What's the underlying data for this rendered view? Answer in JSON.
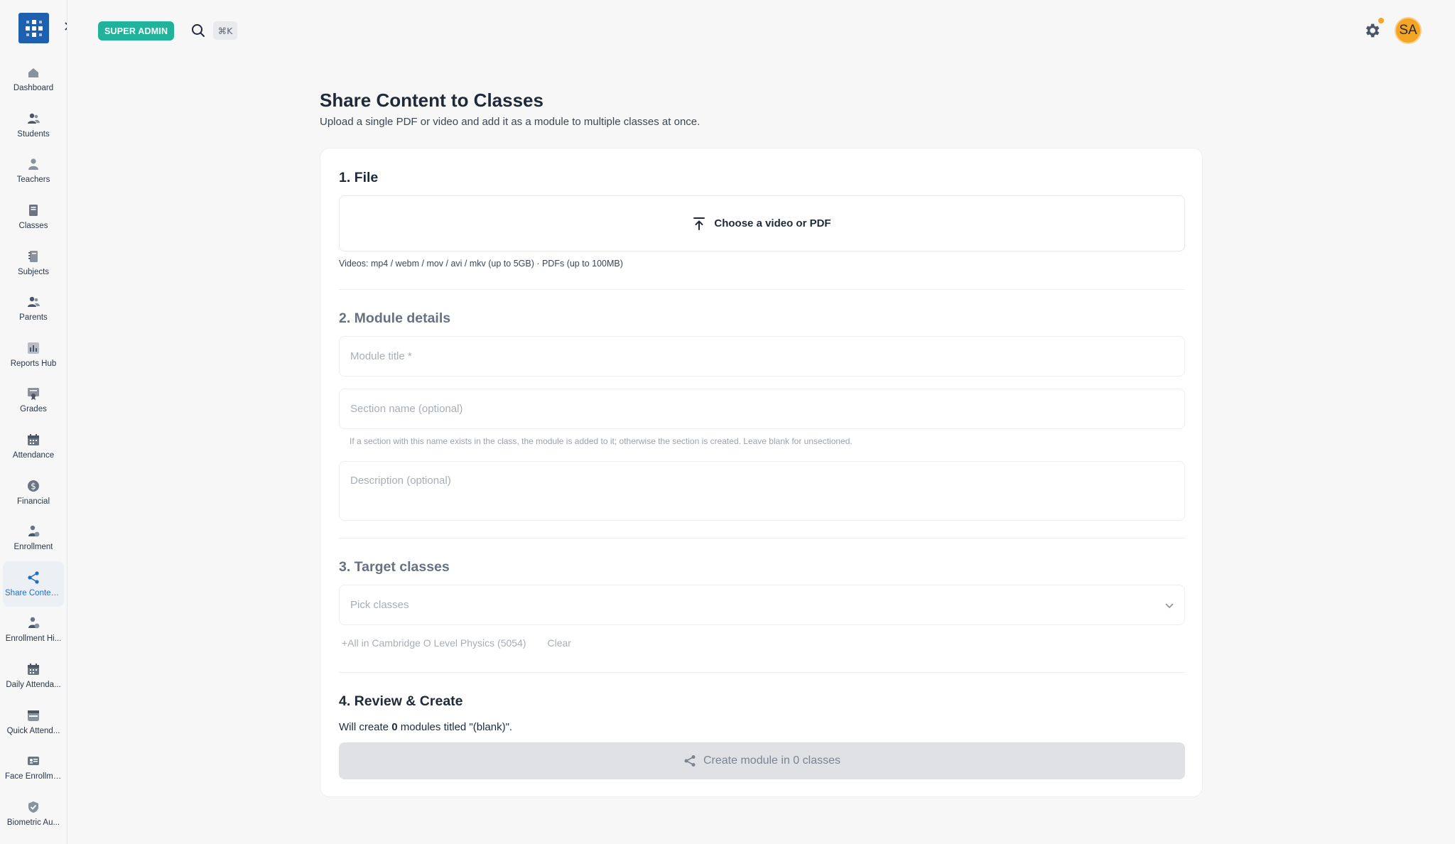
{
  "topbar": {
    "role_badge": "SUPER ADMIN",
    "search_shortcut": "⌘K",
    "avatar_initials": "SA"
  },
  "sidebar": {
    "items": [
      {
        "label": "Dashboard",
        "icon": "home-icon"
      },
      {
        "label": "Students",
        "icon": "users-icon"
      },
      {
        "label": "Teachers",
        "icon": "user-icon"
      },
      {
        "label": "Classes",
        "icon": "book-icon"
      },
      {
        "label": "Subjects",
        "icon": "notebook-icon"
      },
      {
        "label": "Parents",
        "icon": "users-icon"
      },
      {
        "label": "Reports Hub",
        "icon": "bar-chart-icon"
      },
      {
        "label": "Grades",
        "icon": "certificate-icon"
      },
      {
        "label": "Attendance",
        "icon": "calendar-icon"
      },
      {
        "label": "Financial",
        "icon": "dollar-icon"
      },
      {
        "label": "Enrollment",
        "icon": "user-plus-icon"
      },
      {
        "label": "Share Conten...",
        "icon": "share-icon",
        "active": true
      },
      {
        "label": "Enrollment Hi...",
        "icon": "user-history-icon"
      },
      {
        "label": "Daily Attenda...",
        "icon": "calendar-icon"
      },
      {
        "label": "Quick Attend...",
        "icon": "scan-calendar-icon"
      },
      {
        "label": "Face Enrollme...",
        "icon": "id-card-icon"
      },
      {
        "label": "Biometric Au...",
        "icon": "shield-check-icon"
      }
    ]
  },
  "page": {
    "title": "Share Content to Classes",
    "subtitle": "Upload a single PDF or video and add it as a module to multiple classes at once."
  },
  "file_section": {
    "title": "1. File",
    "upload_label": "Choose a video or PDF",
    "hint": "Videos: mp4 / webm / mov / avi / mkv (up to 5GB) · PDFs (up to 100MB)"
  },
  "details_section": {
    "title": "2. Module details",
    "module_title_placeholder": "Module title *",
    "section_name_placeholder": "Section name (optional)",
    "section_hint": "If a section with this name exists in the class, the module is added to it; otherwise the section is created. Leave blank for unsectioned.",
    "description_placeholder": "Description (optional)"
  },
  "target_section": {
    "title": "3. Target classes",
    "picker_placeholder": "Pick classes",
    "add_all_link": "+All in Cambridge O Level Physics (5054)",
    "clear_link": "Clear"
  },
  "review_section": {
    "title": "4. Review & Create",
    "summary_prefix": "Will create ",
    "summary_count": "0",
    "summary_suffix": " modules titled \"(blank)\".",
    "create_button": "Create module in 0 classes"
  },
  "colors": {
    "accent": "#1f6fc6",
    "badge": "#20b39b",
    "avatar": "#f5a524",
    "logo": "#1f5fb0"
  }
}
